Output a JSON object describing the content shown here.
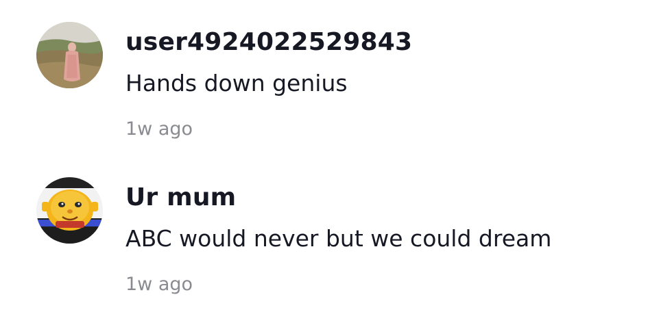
{
  "comments": [
    {
      "avatar_icon": "user-photo-avatar",
      "username": "user4924022529843",
      "text": "Hands down genius",
      "time": "1w ago"
    },
    {
      "avatar_icon": "cartoon-avatar",
      "username": "Ur mum",
      "text": "ABC would never but we could dream",
      "time": "1w ago"
    }
  ],
  "colors": {
    "primary_text": "#161823",
    "secondary_text": "#8a8b91",
    "background": "#ffffff"
  }
}
